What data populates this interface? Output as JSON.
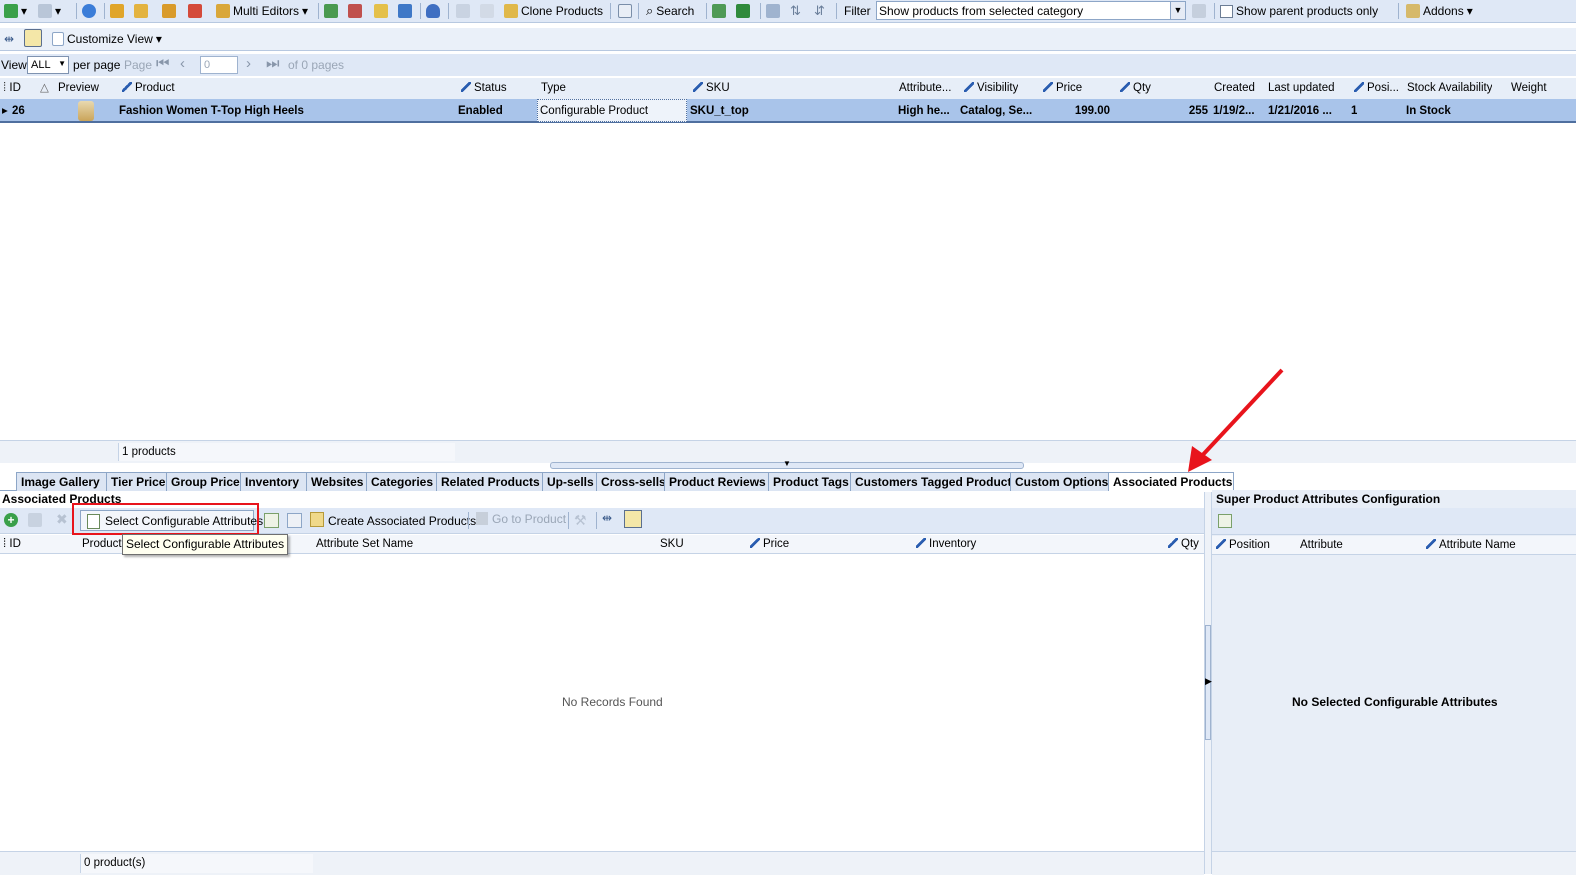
{
  "toolbar": {
    "multi_editors": "Multi Editors",
    "clone_products": "Clone Products",
    "search": "Search",
    "filter_label": "Filter",
    "filter_value": "Show products from selected category",
    "show_parent": "Show parent products only",
    "addons": "Addons"
  },
  "viewbar": {
    "customize_view": "Customize View"
  },
  "pager": {
    "view_label": "View",
    "view_value": "ALL",
    "per_page": "per page",
    "page_label": "Page",
    "page_value": "0",
    "of_pages": "of 0 pages"
  },
  "grid": {
    "headers": {
      "id": "ID",
      "preview": "Preview",
      "product": "Product",
      "status": "Status",
      "type": "Type",
      "sku": "SKU",
      "attribute": "Attribute...",
      "visibility": "Visibility",
      "price": "Price",
      "qty": "Qty",
      "created": "Created",
      "last_updated": "Last updated",
      "position": "Posi...",
      "stock": "Stock Availability",
      "weight": "Weight"
    },
    "row": {
      "id": "26",
      "product": "Fashion Women T-Top High Heels",
      "status": "Enabled",
      "type": "Configurable Product",
      "sku": "SKU_t_top",
      "attribute": "High he...",
      "visibility": "Catalog, Se...",
      "price": "199.00",
      "qty": "255",
      "created": "1/19/2...",
      "last_updated": "1/21/2016 ...",
      "position": "1",
      "stock": "In Stock"
    },
    "footer_count": "1 products"
  },
  "tabs": [
    "Image Gallery",
    "Tier Price",
    "Group Price",
    "Inventory",
    "Websites",
    "Categories",
    "Related Products",
    "Up-sells",
    "Cross-sells",
    "Product Reviews",
    "Product Tags",
    "Customers Tagged Product",
    "Custom Options",
    "Associated Products"
  ],
  "assoc": {
    "title": "Associated Products",
    "select_btn": "Select Configurable Attributes",
    "tooltip": "Select Configurable Attributes",
    "create_btn": "Create Associated Products",
    "goto_btn": "Go to Product",
    "headers": {
      "id": "ID",
      "product": "Product",
      "attr_set": "Attribute Set Name",
      "sku": "SKU",
      "price": "Price",
      "inventory": "Inventory",
      "qty": "Qty"
    },
    "empty": "No Records Found",
    "footer_count": "0 product(s)"
  },
  "super": {
    "title": "Super Product Attributes Configuration",
    "headers": {
      "position": "Position",
      "attribute": "Attribute",
      "attribute_name": "Attribute Name"
    },
    "empty": "No Selected Configurable Attributes"
  },
  "colors": {
    "toolbar_bg": "#dfe8f6",
    "selected_row": "#a9c4ea",
    "highlight_box": "#e8141c",
    "arrow": "#e8141c"
  }
}
